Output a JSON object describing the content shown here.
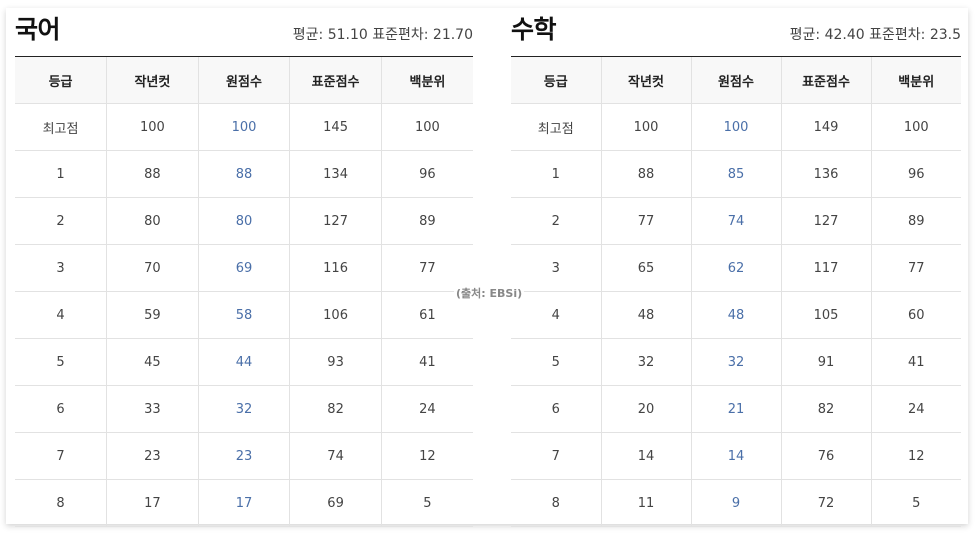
{
  "korean": {
    "subject": "국어",
    "stats": "평균: 51.10 표준편차: 21.70",
    "headers": [
      "등급",
      "작년컷",
      "원점수",
      "표준점수",
      "백분위"
    ],
    "rows": [
      [
        "최고점",
        "100",
        "100",
        "145",
        "100"
      ],
      [
        "1",
        "88",
        "88",
        "134",
        "96"
      ],
      [
        "2",
        "80",
        "80",
        "127",
        "89"
      ],
      [
        "3",
        "70",
        "69",
        "116",
        "77"
      ],
      [
        "4",
        "59",
        "58",
        "106",
        "61"
      ],
      [
        "5",
        "45",
        "44",
        "93",
        "41"
      ],
      [
        "6",
        "33",
        "32",
        "82",
        "24"
      ],
      [
        "7",
        "23",
        "23",
        "74",
        "12"
      ],
      [
        "8",
        "17",
        "17",
        "69",
        "5"
      ]
    ]
  },
  "math": {
    "subject": "수학",
    "stats": "평균: 42.40 표준편차: 23.5",
    "headers": [
      "등급",
      "작년컷",
      "원점수",
      "표준점수",
      "백분위"
    ],
    "rows": [
      [
        "최고점",
        "100",
        "100",
        "149",
        "100"
      ],
      [
        "1",
        "88",
        "85",
        "136",
        "96"
      ],
      [
        "2",
        "77",
        "74",
        "127",
        "89"
      ],
      [
        "3",
        "65",
        "62",
        "117",
        "77"
      ],
      [
        "4",
        "48",
        "48",
        "105",
        "60"
      ],
      [
        "5",
        "32",
        "32",
        "91",
        "41"
      ],
      [
        "6",
        "20",
        "21",
        "82",
        "24"
      ],
      [
        "7",
        "14",
        "14",
        "76",
        "12"
      ],
      [
        "8",
        "11",
        "9",
        "72",
        "5"
      ]
    ]
  },
  "source": "(출처: EBSi)",
  "colors": {
    "raw_score": "#4a6fa8",
    "header_bg": "#f8f8f8",
    "border": "#e2e2e2"
  }
}
